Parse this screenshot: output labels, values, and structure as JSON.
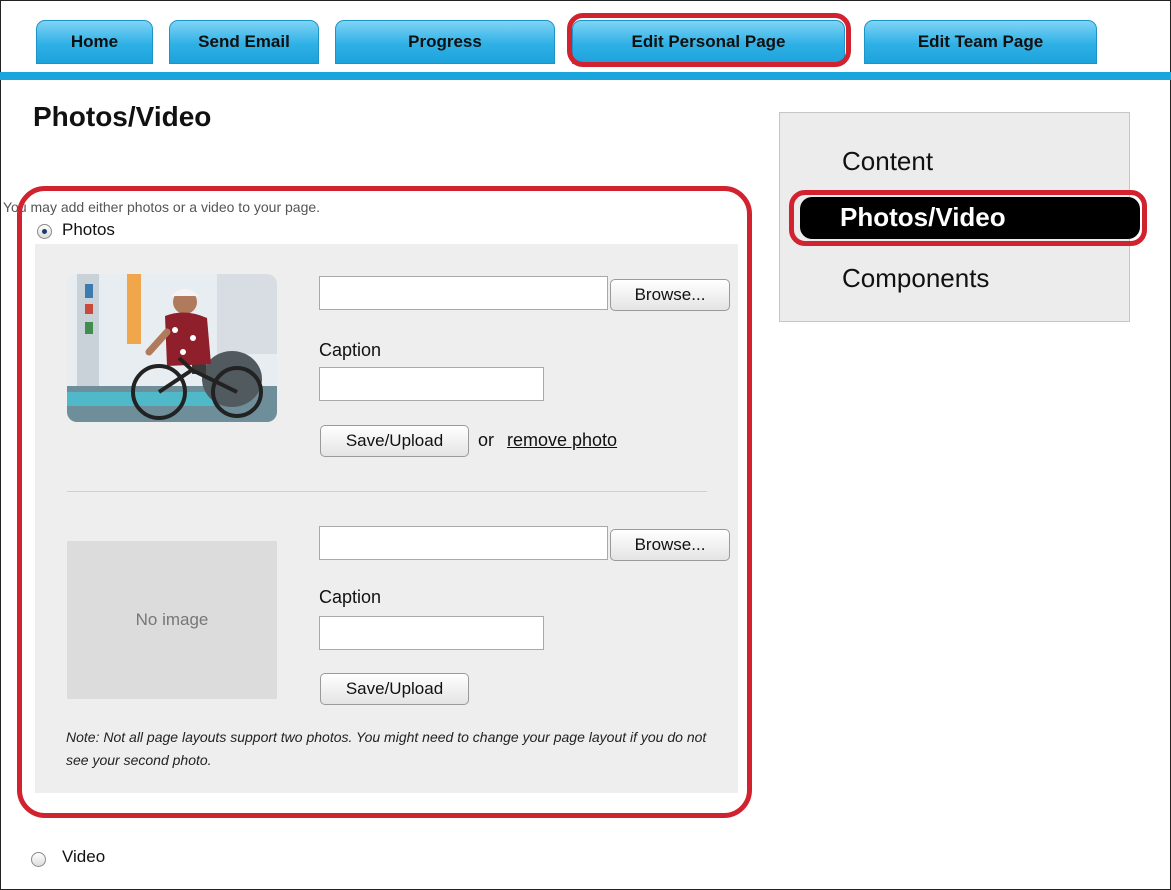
{
  "nav": {
    "tabs": [
      "Home",
      "Send Email",
      "Progress",
      "Edit Personal Page",
      "Edit Team Page"
    ],
    "active": "Edit Personal Page"
  },
  "page_title": "Photos/Video",
  "sidebar": {
    "items": [
      "Content",
      "Photos/Video",
      "Components"
    ],
    "active": "Photos/Video"
  },
  "media": {
    "intro": "You may add either photos or a video to your page.",
    "photos_label": "Photos",
    "video_label": "Video",
    "selected": "Photos"
  },
  "photo1": {
    "file_value": "",
    "browse_label": "Browse...",
    "caption_label": "Caption",
    "caption_value": "",
    "save_label": "Save/Upload",
    "or_text": "or",
    "remove_label": "remove photo"
  },
  "photo2": {
    "file_value": "",
    "browse_label": "Browse...",
    "caption_label": "Caption",
    "caption_value": "",
    "save_label": "Save/Upload",
    "no_image_text": "No image"
  },
  "note": "Note: Not all page layouts support two photos. You might need to change your page layout if you do not see your second photo.",
  "colors": {
    "nav_blue": "#2fb1e6",
    "highlight_red": "#d12230",
    "panel_gray": "#eeeeee"
  }
}
